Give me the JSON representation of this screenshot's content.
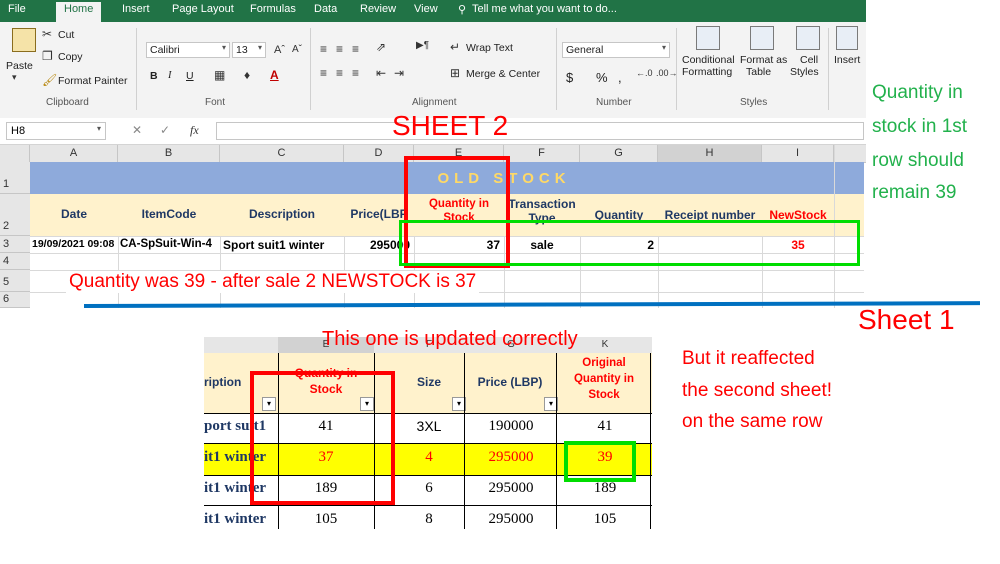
{
  "ribbon": {
    "menu": [
      "File",
      "Home",
      "Insert",
      "Page Layout",
      "Formulas",
      "Data",
      "Review",
      "View",
      "Tell me what you want to do..."
    ],
    "clipboard": {
      "paste": "Paste",
      "cut": "Cut",
      "copy": "Copy",
      "format_painter": "Format Painter",
      "label": "Clipboard"
    },
    "font": {
      "name": "Calibri",
      "size": "13",
      "bold": "B",
      "italic": "I",
      "underline": "U",
      "label": "Font"
    },
    "alignment": {
      "wrap": "Wrap Text",
      "merge": "Merge & Center",
      "label": "Alignment"
    },
    "number": {
      "format": "General",
      "currency": "$",
      "percent": "%",
      "comma": ",",
      "label": "Number"
    },
    "styles": {
      "conditional": "Conditional",
      "conditional2": "Formatting",
      "format_as": "Format as",
      "format_as2": "Table",
      "cell_styles": "Cell",
      "cell_styles2": "Styles",
      "label": "Styles"
    },
    "insert": "Insert"
  },
  "formula_bar": {
    "name_box": "H8",
    "fx": "fx"
  },
  "sheet2": {
    "columns": [
      "A",
      "B",
      "C",
      "D",
      "E",
      "F",
      "G",
      "H",
      "I"
    ],
    "rows": [
      "1",
      "2",
      "3",
      "4",
      "5",
      "6"
    ],
    "banner": "OLD STOCK",
    "headers": {
      "date": "Date",
      "itemcode": "ItemCode",
      "description": "Description",
      "price": "Price(LBP",
      "qty_in_stock": "Quantity in Stock",
      "transaction": "Transaction Type",
      "quantity": "Quantity",
      "receipt": "Receipt number",
      "newstock": "NewStock"
    },
    "row3": {
      "date": "19/09/2021 09:08",
      "itemcode": "CA-SpSuit-Win-4",
      "description": "Sport suit1 winter",
      "price": "295000",
      "qty_in_stock": "37",
      "transaction": "sale",
      "quantity": "2",
      "newstock": "35"
    }
  },
  "annotations": {
    "sheet2_title": "SHEET 2",
    "sheet1_title": "Sheet 1",
    "right_note": [
      "Quantity in",
      "stock in 1st",
      "row should",
      "remain 39"
    ],
    "qty_note": "Quantity was 39 - after sale 2 NEWSTOCK is 37",
    "updated_note": "This one is updated correctly",
    "reaffected_note": [
      "But it reaffected",
      "the second sheet!",
      "on the same row"
    ]
  },
  "sheet1": {
    "col_letters": [
      "E",
      "F",
      "G",
      "K"
    ],
    "headers": {
      "description": "ription",
      "qty_in_stock": "Quantity in Stock",
      "size": "Size",
      "price": "Price (LBP)",
      "original_qty": "Original Quantity in Stock"
    },
    "rows": [
      {
        "description": "port suit1",
        "qty": "41",
        "size": "3XL",
        "price": "190000",
        "original": "41",
        "highlight": false
      },
      {
        "description": "it1 winter",
        "qty": "37",
        "size": "4",
        "price": "295000",
        "original": "39",
        "highlight": true
      },
      {
        "description": "it1 winter",
        "qty": "189",
        "size": "6",
        "price": "295000",
        "original": "189",
        "highlight": false
      },
      {
        "description": "it1 winter",
        "qty": "105",
        "size": "8",
        "price": "295000",
        "original": "105",
        "highlight": false
      }
    ]
  },
  "colors": {
    "red": "#ff0000",
    "green": "#00cc00",
    "note_green": "#22b14c",
    "blue": "#0070c0",
    "highlight": "#ffff00",
    "excel_green": "#217346"
  }
}
